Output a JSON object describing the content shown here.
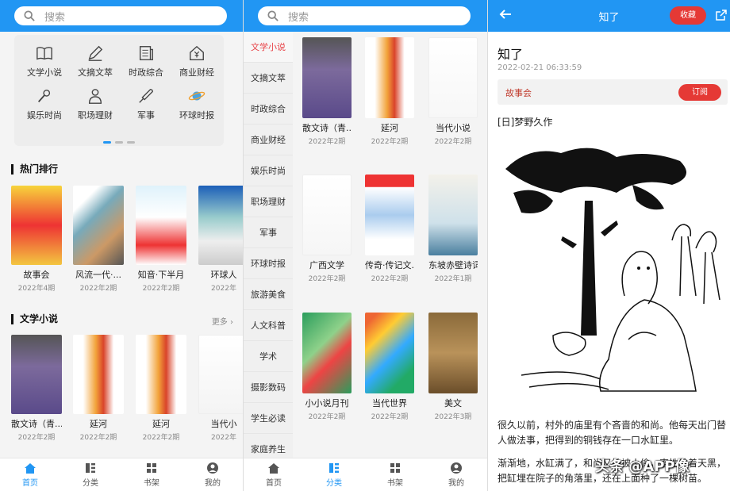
{
  "search": {
    "placeholder": "搜索"
  },
  "home": {
    "categories": [
      {
        "label": "文学小说",
        "icon": "book-icon"
      },
      {
        "label": "文摘文萃",
        "icon": "pen-icon"
      },
      {
        "label": "时政综合",
        "icon": "newspaper-icon"
      },
      {
        "label": "商业财经",
        "icon": "yuan-house-icon"
      },
      {
        "label": "娱乐时尚",
        "icon": "microphone-icon"
      },
      {
        "label": "职场理财",
        "icon": "person-icon"
      },
      {
        "label": "军事",
        "icon": "rocket-icon"
      },
      {
        "label": "环球时报",
        "icon": "planet-icon"
      }
    ],
    "hot_title": "热门排行",
    "hot": [
      {
        "title": "故事会",
        "date": "2022年4期"
      },
      {
        "title": "风流一代·...",
        "date": "2022年2期"
      },
      {
        "title": "知音·下半月",
        "date": "2022年2期"
      },
      {
        "title": "环球人",
        "date": "2022年"
      }
    ],
    "lit_title": "文学小说",
    "more": "更多",
    "lit": [
      {
        "title": "散文诗（青...",
        "date": "2022年2期"
      },
      {
        "title": "延河",
        "date": "2022年2期"
      },
      {
        "title": "延河",
        "date": "2022年2期"
      },
      {
        "title": "当代小",
        "date": "2022年"
      }
    ]
  },
  "nav": [
    {
      "label": "首页",
      "icon": "home-icon"
    },
    {
      "label": "分类",
      "icon": "list-icon"
    },
    {
      "label": "书架",
      "icon": "grid-icon"
    },
    {
      "label": "我的",
      "icon": "user-icon"
    }
  ],
  "category_page": {
    "sidebar": [
      "文学小说",
      "文摘文萃",
      "时政综合",
      "商业财经",
      "娱乐时尚",
      "职场理财",
      "军事",
      "环球时报",
      "旅游美食",
      "人文科普",
      "学术",
      "摄影数码",
      "学生必读",
      "家庭养生"
    ],
    "magazines": [
      {
        "title": "散文诗（青...",
        "date": "2022年2期"
      },
      {
        "title": "延河",
        "date": "2022年2期"
      },
      {
        "title": "当代小说",
        "date": "2022年2期"
      },
      {
        "title": "广西文学",
        "date": "2022年2期"
      },
      {
        "title": "传奇·传记文...",
        "date": "2022年2期"
      },
      {
        "title": "东坡赤壁诗词",
        "date": "2022年1期"
      },
      {
        "title": "小小说月刊",
        "date": "2022年2期"
      },
      {
        "title": "当代世界",
        "date": "2022年2期"
      },
      {
        "title": "美文",
        "date": "2022年3期"
      }
    ]
  },
  "article": {
    "bar_title": "知了",
    "fav_label": "收藏",
    "title": "知了",
    "date": "2022-02-21 06:33:59",
    "source": "故事会",
    "subscribe": "订阅",
    "author": "[日]梦野久作",
    "p1": "很久以前，村外的庙里有个吝啬的和尚。他每天出门替人做法事，把得到的铜钱存在一口水缸里。",
    "p2": "渐渐地，水缸满了，和尚又怕被小偷，索性趁着天黑，把缸埋在院子的角落里，还在上面种了一棵树苗。"
  },
  "watermark": "头条 @APP像"
}
